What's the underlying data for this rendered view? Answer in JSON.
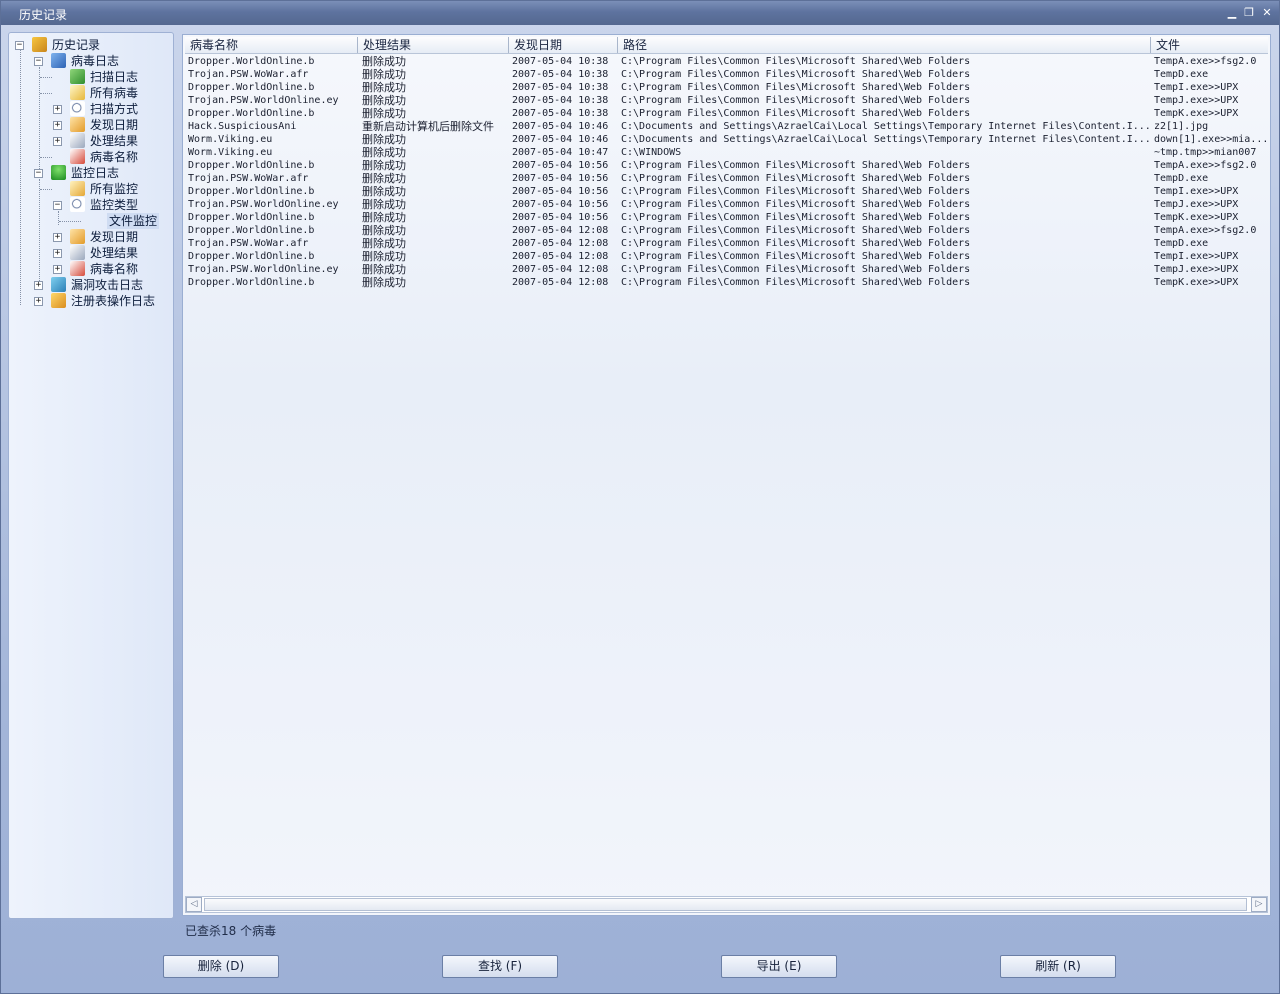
{
  "window": {
    "title": "历史记录",
    "controls": [
      "minimize",
      "restore",
      "close"
    ]
  },
  "tree": {
    "root": "历史记录",
    "virus_log": "病毒日志",
    "virus_log_children": [
      "扫描日志",
      "所有病毒",
      "扫描方式",
      "发现日期",
      "处理结果",
      "病毒名称"
    ],
    "monitor_log": "监控日志",
    "all_monitor": "所有监控",
    "monitor_type": "监控类型",
    "file_monitor": "文件监控",
    "monitor_children_after": [
      "发现日期",
      "处理结果",
      "病毒名称"
    ],
    "exploit_log": "漏洞攻击日志",
    "registry_log": "注册表操作日志"
  },
  "table": {
    "columns": [
      "病毒名称",
      "处理结果",
      "发现日期",
      "路径",
      "文件"
    ],
    "rows": [
      [
        "Dropper.WorldOnline.b",
        "删除成功",
        "2007-05-04 10:38",
        "C:\\Program Files\\Common Files\\Microsoft Shared\\Web Folders",
        "TempA.exe>>fsg2.0"
      ],
      [
        "Trojan.PSW.WoWar.afr",
        "删除成功",
        "2007-05-04 10:38",
        "C:\\Program Files\\Common Files\\Microsoft Shared\\Web Folders",
        "TempD.exe"
      ],
      [
        "Dropper.WorldOnline.b",
        "删除成功",
        "2007-05-04 10:38",
        "C:\\Program Files\\Common Files\\Microsoft Shared\\Web Folders",
        "TempI.exe>>UPX"
      ],
      [
        "Trojan.PSW.WorldOnline.ey",
        "删除成功",
        "2007-05-04 10:38",
        "C:\\Program Files\\Common Files\\Microsoft Shared\\Web Folders",
        "TempJ.exe>>UPX"
      ],
      [
        "Dropper.WorldOnline.b",
        "删除成功",
        "2007-05-04 10:38",
        "C:\\Program Files\\Common Files\\Microsoft Shared\\Web Folders",
        "TempK.exe>>UPX"
      ],
      [
        "Hack.SuspiciousAni",
        "重新启动计算机后删除文件",
        "2007-05-04 10:46",
        "C:\\Documents and Settings\\AzraelCai\\Local Settings\\Temporary Internet Files\\Content.I...",
        "z2[1].jpg"
      ],
      [
        "Worm.Viking.eu",
        "删除成功",
        "2007-05-04 10:46",
        "C:\\Documents and Settings\\AzraelCai\\Local Settings\\Temporary Internet Files\\Content.I...",
        "down[1].exe>>mia..."
      ],
      [
        "Worm.Viking.eu",
        "删除成功",
        "2007-05-04 10:47",
        "C:\\WINDOWS",
        "~tmp.tmp>>mian007"
      ],
      [
        "Dropper.WorldOnline.b",
        "删除成功",
        "2007-05-04 10:56",
        "C:\\Program Files\\Common Files\\Microsoft Shared\\Web Folders",
        "TempA.exe>>fsg2.0"
      ],
      [
        "Trojan.PSW.WoWar.afr",
        "删除成功",
        "2007-05-04 10:56",
        "C:\\Program Files\\Common Files\\Microsoft Shared\\Web Folders",
        "TempD.exe"
      ],
      [
        "Dropper.WorldOnline.b",
        "删除成功",
        "2007-05-04 10:56",
        "C:\\Program Files\\Common Files\\Microsoft Shared\\Web Folders",
        "TempI.exe>>UPX"
      ],
      [
        "Trojan.PSW.WorldOnline.ey",
        "删除成功",
        "2007-05-04 10:56",
        "C:\\Program Files\\Common Files\\Microsoft Shared\\Web Folders",
        "TempJ.exe>>UPX"
      ],
      [
        "Dropper.WorldOnline.b",
        "删除成功",
        "2007-05-04 10:56",
        "C:\\Program Files\\Common Files\\Microsoft Shared\\Web Folders",
        "TempK.exe>>UPX"
      ],
      [
        "Dropper.WorldOnline.b",
        "删除成功",
        "2007-05-04 12:08",
        "C:\\Program Files\\Common Files\\Microsoft Shared\\Web Folders",
        "TempA.exe>>fsg2.0"
      ],
      [
        "Trojan.PSW.WoWar.afr",
        "删除成功",
        "2007-05-04 12:08",
        "C:\\Program Files\\Common Files\\Microsoft Shared\\Web Folders",
        "TempD.exe"
      ],
      [
        "Dropper.WorldOnline.b",
        "删除成功",
        "2007-05-04 12:08",
        "C:\\Program Files\\Common Files\\Microsoft Shared\\Web Folders",
        "TempI.exe>>UPX"
      ],
      [
        "Trojan.PSW.WorldOnline.ey",
        "删除成功",
        "2007-05-04 12:08",
        "C:\\Program Files\\Common Files\\Microsoft Shared\\Web Folders",
        "TempJ.exe>>UPX"
      ],
      [
        "Dropper.WorldOnline.b",
        "删除成功",
        "2007-05-04 12:08",
        "C:\\Program Files\\Common Files\\Microsoft Shared\\Web Folders",
        "TempK.exe>>UPX"
      ]
    ]
  },
  "status_text": "已查杀18 个病毒",
  "buttons": {
    "delete": "删除 (D)",
    "find": "查找 (F)",
    "export": "导出 (E)",
    "refresh": "刷新 (R)"
  },
  "colors": {
    "titlebar": "#5e739f",
    "window_bg": "#a4b6d9",
    "panel_bg": "#f2f5fb"
  }
}
